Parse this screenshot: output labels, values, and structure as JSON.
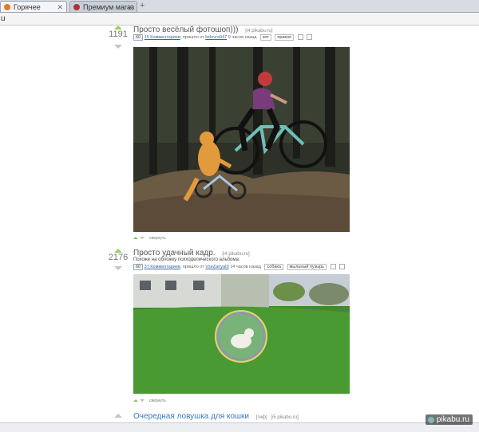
{
  "tabs": [
    {
      "label": "Горячее",
      "active": true
    },
    {
      "label": "Премиум магаз",
      "active": false
    }
  ],
  "new_tab": "+",
  "address": "u",
  "posts": [
    {
      "score": "1191",
      "title": "Просто весёлый фотошоп)))",
      "source": "[i4.pikabu.ru]",
      "desc": "",
      "meta": {
        "badge": "60",
        "comments": "15 Комментариев",
        "posted_by": "; пришло от",
        "author": "kelevra947",
        "time": "9 часов назад",
        "tags": [
          "кот",
          "прикол"
        ]
      },
      "footer": "свернуть"
    },
    {
      "score": "2176",
      "title": "Просто удачный кадр.",
      "source": "[i4.pikabu.ru]",
      "desc": "Похоже на обложку психоделического альбома.",
      "meta": {
        "badge": "60",
        "comments": "37 Комментариев",
        "posted_by": "; пришло от",
        "author": "VseZanyat0",
        "time": "14 часов назад",
        "tags": [
          "собака",
          "мыльный пузырь"
        ]
      },
      "footer": "свернуть"
    },
    {
      "score": "",
      "title": "Очередная ловушка для кошки",
      "source": "[i5.pikabu.ru]",
      "badge": "[гиф]"
    }
  ],
  "watermark": "pikabu.ru",
  "colors": {
    "accent_up": "#9acd5a",
    "link": "#3a66a0",
    "title_blue": "#3b79b8"
  }
}
